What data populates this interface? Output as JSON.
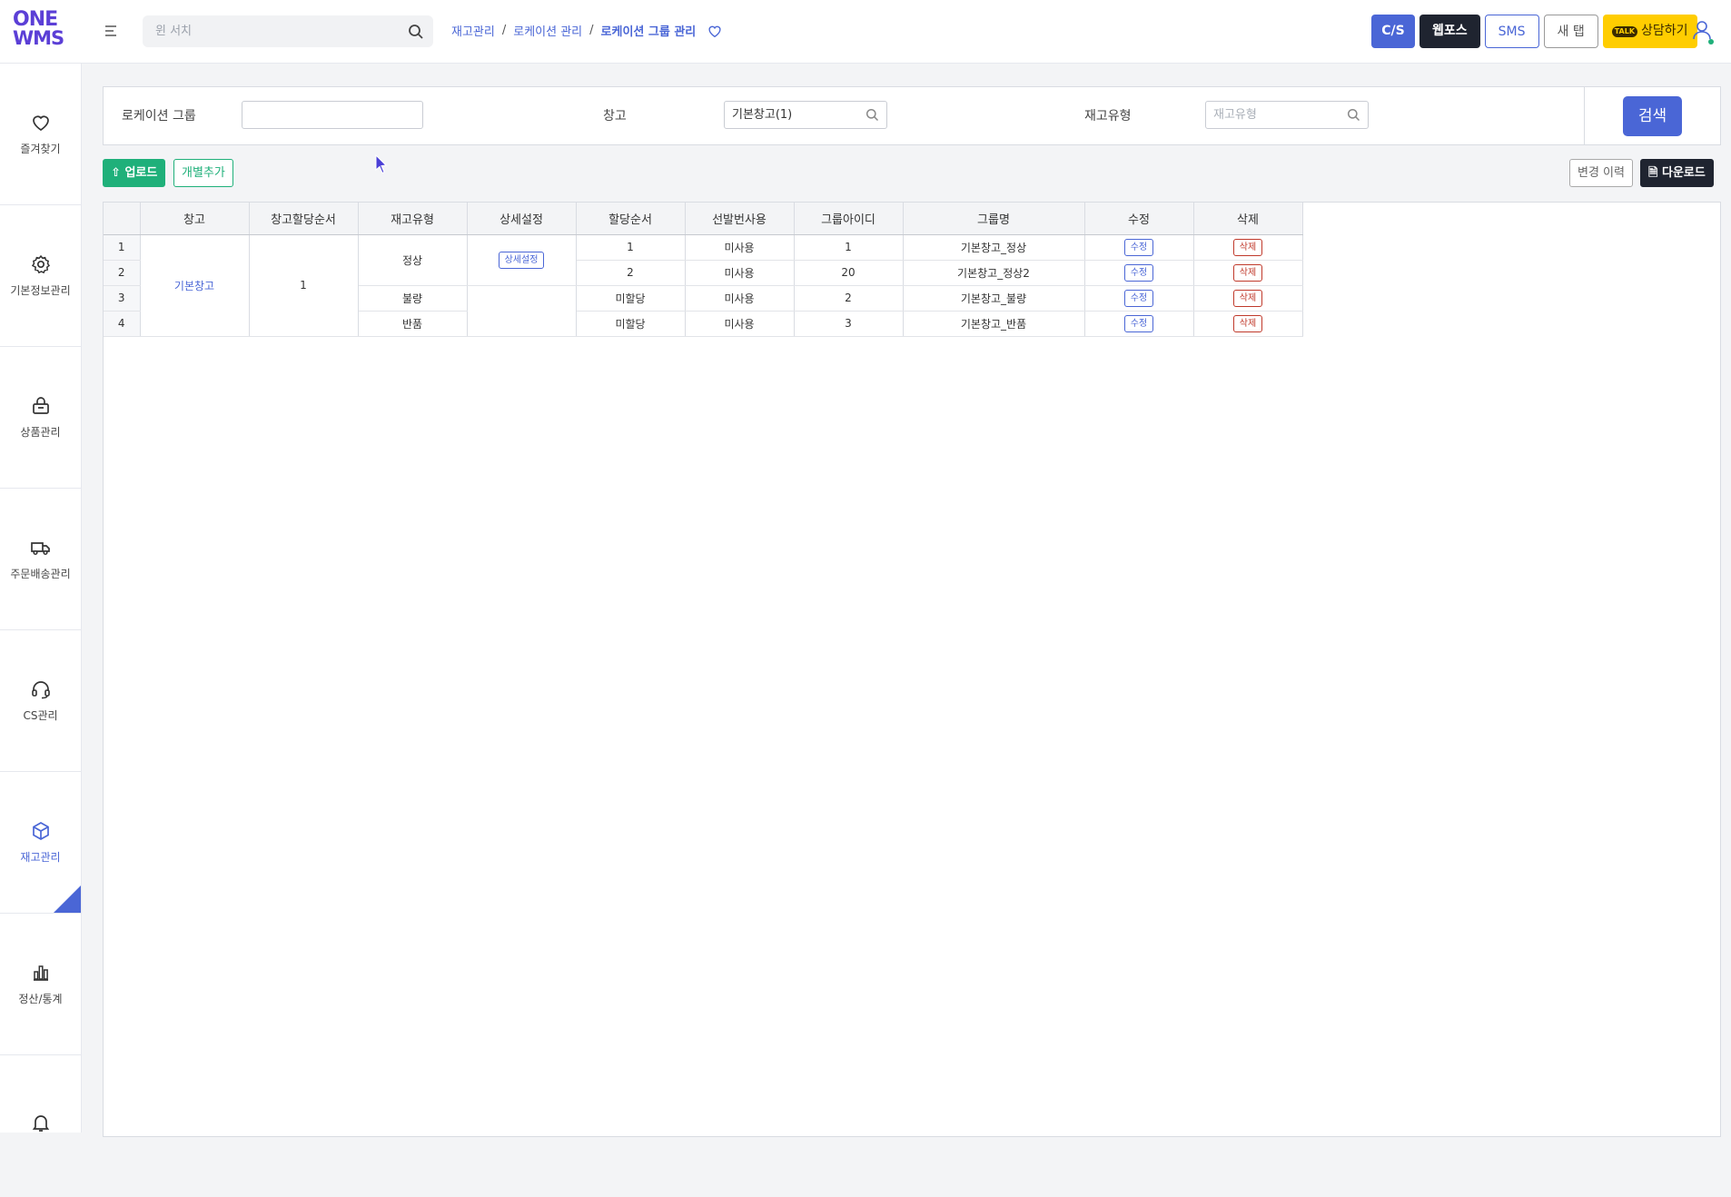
{
  "app": {
    "logo_line1": "ONE",
    "logo_line2": "WMS",
    "brand_color": "#5b3fd6",
    "accent_color": "#4a66d6"
  },
  "search": {
    "placeholder": "윈 서치"
  },
  "breadcrumb": {
    "items": [
      "재고관리",
      "로케이션 관리",
      "로케이션 그룹 관리"
    ],
    "separator": "/"
  },
  "topbar": {
    "cs": "C/S",
    "webforce": "웹포스",
    "sms": "SMS",
    "newtab": "새 탭",
    "talk_badge": "TALK",
    "consult": "상담하기"
  },
  "sidebar": {
    "items": [
      {
        "label": "즐겨찾기",
        "icon": "heart-icon"
      },
      {
        "label": "기본정보관리",
        "icon": "gear-icon"
      },
      {
        "label": "상품관리",
        "icon": "bag-icon"
      },
      {
        "label": "주문배송관리",
        "icon": "truck-icon"
      },
      {
        "label": "CS관리",
        "icon": "headset-icon"
      },
      {
        "label": "재고관리",
        "icon": "box-icon",
        "active": true
      },
      {
        "label": "정산/통계",
        "icon": "bar-chart-icon"
      },
      {
        "label": "",
        "icon": "bell-icon"
      }
    ]
  },
  "filters": {
    "group_label": "로케이션 그룹",
    "group_value": "",
    "warehouse_label": "창고",
    "warehouse_value": "기본창고(1)",
    "stock_type_label": "재고유형",
    "stock_type_placeholder": "재고유형",
    "search_button": "검색"
  },
  "actions": {
    "upload": "업로드",
    "add": "개별추가",
    "history": "변경 이력",
    "download": "다운로드"
  },
  "table": {
    "headers": [
      "창고",
      "창고할당순서",
      "재고유형",
      "상세설정",
      "할당순서",
      "선발번사용",
      "그룹아이디",
      "그룹명",
      "수정",
      "삭제"
    ],
    "warehouse": "기본창고",
    "warehouse_order": "1",
    "detail_button": "상세설정",
    "edit_button": "수정",
    "delete_button": "삭제",
    "rows": [
      {
        "no": "1",
        "stock_type": "정상",
        "alloc_order": "1",
        "first_use": "미사용",
        "group_id": "1",
        "group_name": "기본창고_정상"
      },
      {
        "no": "2",
        "stock_type": "",
        "alloc_order": "2",
        "first_use": "미사용",
        "group_id": "20",
        "group_name": "기본창고_정상2"
      },
      {
        "no": "3",
        "stock_type": "불량",
        "alloc_order": "미할당",
        "first_use": "미사용",
        "group_id": "2",
        "group_name": "기본창고_불량"
      },
      {
        "no": "4",
        "stock_type": "반품",
        "alloc_order": "미할당",
        "first_use": "미사용",
        "group_id": "3",
        "group_name": "기본창고_반품"
      }
    ]
  }
}
